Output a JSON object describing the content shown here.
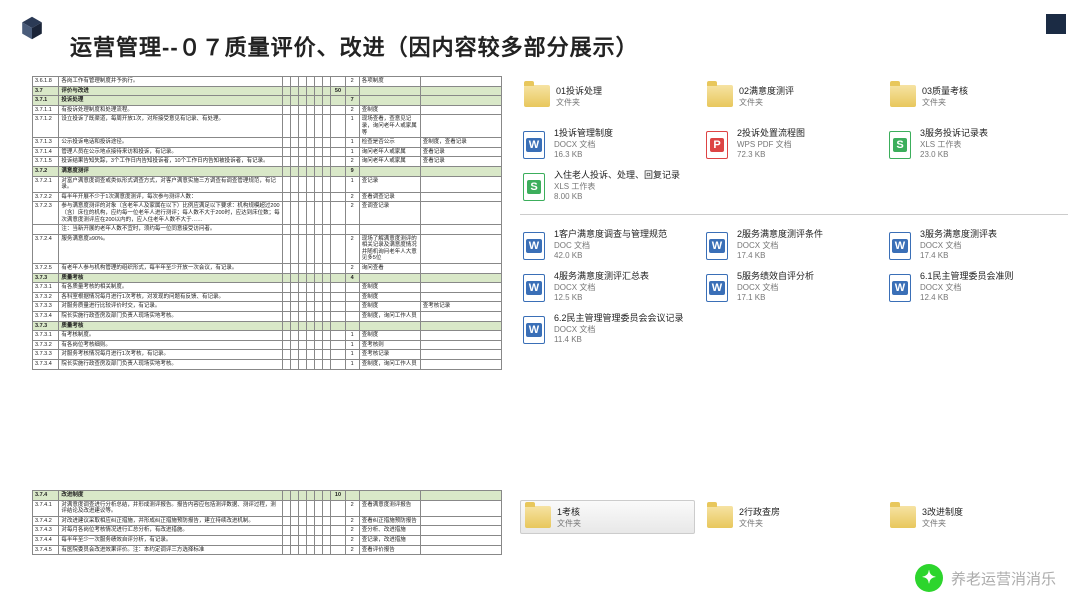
{
  "title": "运营管理--０７质量评价、改进（因内容较多部分展示）",
  "watermark": "养老运营消消乐",
  "table1": [
    {
      "id": "3.6.1.8",
      "desc": "各岗工作有管理制度并予执行。",
      "n1": "",
      "n2": "2",
      "r1": "各项制度",
      "r2": ""
    },
    {
      "id": "3.7",
      "desc": "评价与改进",
      "n1": "50",
      "n2": "",
      "r1": "",
      "r2": "",
      "cls": "sec"
    },
    {
      "id": "3.7.1",
      "desc": "投诉处理",
      "n1": "",
      "n2": "7",
      "r1": "",
      "r2": "",
      "cls": "sec"
    },
    {
      "id": "3.7.1.1",
      "desc": "有投诉处理制度和处理流程。",
      "n1": "",
      "n2": "2",
      "r1": "查制度",
      "r2": ""
    },
    {
      "id": "3.7.1.2",
      "desc": "设立投诉了既渠道，每周开放1次，对所接受意见有记录、有处理。",
      "n1": "",
      "n2": "1",
      "r1": "现场查看，查意见记录，询问老年人或家属等",
      "r2": ""
    },
    {
      "id": "3.7.1.3",
      "desc": "公示投诉电话和投诉途径。",
      "n1": "",
      "n2": "1",
      "r1": "检查是否公示",
      "r2": "查制度，查看记录"
    },
    {
      "id": "3.7.1.4",
      "desc": "管理人员在公示地点接待来访和投诉，有记录。",
      "n1": "",
      "n2": "1",
      "r1": "询问老年人或家属",
      "r2": "查看记录"
    },
    {
      "id": "3.7.1.5",
      "desc": "投诉结果告知失踪，3个工作日内告知投诉者，10个工作日内告知被投诉者，有记录。",
      "n1": "",
      "n2": "2",
      "r1": "询问老年人或家属",
      "r2": "查看记录"
    },
    {
      "id": "3.7.2",
      "desc": "满意度测评",
      "n1": "",
      "n2": "9",
      "r1": "",
      "r2": "",
      "cls": "sec"
    },
    {
      "id": "3.7.2.1",
      "desc": "对富户满意度调查或类似形式调查方式，对客户满意实施三方调查有调查管理规范，有记录。",
      "n1": "",
      "n2": "1",
      "r1": "查记录",
      "r2": ""
    },
    {
      "id": "3.7.2.2",
      "desc": "每半年开展不少于1次满意度测评，每次参与测评人数：",
      "n1": "",
      "n2": "2",
      "r1": "查看调查记录",
      "r2": ""
    },
    {
      "id": "3.7.2.3",
      "desc": "参与满意度测评的对象（含老年人及家属在以下）比例应满足以下要求：机构规模超过200（含）床位的机构，应约每一位老年人进行测评；每人数不大于200时，应达到床位数；每次满意度测评应在200以内的，应入住老年人数不大于……",
      "n1": "",
      "n2": "2",
      "r1": "查调查记录",
      "r2": ""
    },
    {
      "id": "",
      "desc": "注：当新开展的老年人数不宜时，须约每一位同意接受访问者。",
      "n1": "",
      "n2": "",
      "r1": "",
      "r2": ""
    },
    {
      "id": "3.7.2.4",
      "desc": "服务满意度≥90%。",
      "n1": "",
      "n2": "2",
      "r1": "现场了解满意度测评的相关记录及满意度情况并随机询问老年人大意见多5位",
      "r2": ""
    },
    {
      "id": "3.7.2.5",
      "desc": "有老年人参与机构管理的组织形式，每半年至少开放一次会议，有记录。",
      "n1": "",
      "n2": "2",
      "r1": "询问查看",
      "r2": ""
    },
    {
      "id": "3.7.3",
      "desc": "质量考核",
      "n1": "",
      "n2": "4",
      "r1": "",
      "r2": "",
      "cls": "sec"
    },
    {
      "id": "3.7.3.1",
      "desc": "有各质量考核的相关制度。",
      "n1": "",
      "n2": "",
      "r1": "查制度",
      "r2": ""
    },
    {
      "id": "3.7.3.2",
      "desc": "各科室根据情况每月进行1次考核，对发现的问题有反馈、有记录。",
      "n1": "",
      "n2": "",
      "r1": "查制度",
      "r2": ""
    },
    {
      "id": "3.7.3.3",
      "desc": "对服务质量进行比较评价时交，有记录。",
      "n1": "",
      "n2": "",
      "r1": "查制度",
      "r2": "查考核记录"
    },
    {
      "id": "3.7.3.4",
      "desc": "院长实施行政查房及部门负责人现场实地考核。",
      "n1": "",
      "n2": "",
      "r1": "查制度，询问工作人员",
      "r2": ""
    },
    {
      "id": "3.7.3",
      "desc": "质量考核",
      "n1": "",
      "n2": "",
      "r1": "",
      "r2": "",
      "cls": "sec"
    },
    {
      "id": "3.7.3.1",
      "desc": "有考核制度。",
      "n1": "",
      "n2": "1",
      "r1": "查制度",
      "r2": ""
    },
    {
      "id": "3.7.3.2",
      "desc": "有各岗位考核细则。",
      "n1": "",
      "n2": "1",
      "r1": "查考核则",
      "r2": ""
    },
    {
      "id": "3.7.3.3",
      "desc": "对服务考核情况每月进行1次考核，有记录。",
      "n1": "",
      "n2": "1",
      "r1": "查考核记录",
      "r2": ""
    },
    {
      "id": "3.7.3.4",
      "desc": "院长实施行政查房及部门负责人现场实地考核。",
      "n1": "",
      "n2": "1",
      "r1": "查制度，询问工作人员",
      "r2": ""
    }
  ],
  "table2": [
    {
      "id": "3.7.4",
      "desc": "改进制度",
      "n1": "10",
      "n2": "",
      "r1": "",
      "r2": "",
      "cls": "sec"
    },
    {
      "id": "3.7.4.1",
      "desc": "对满意度调查进行分析总结，并形成测评报告。报告内容应包括测评数据、测评过程，测评结论及改进建议等。",
      "n1": "",
      "n2": "2",
      "r1": "查看满意度测评报告",
      "r2": ""
    },
    {
      "id": "3.7.4.2",
      "desc": "对改进建议采取相应纠正措施，并形成纠正措施预防报告，建立持续改进机制。",
      "n1": "",
      "n2": "2",
      "r1": "查看纠正措施预防报告",
      "r2": ""
    },
    {
      "id": "3.7.4.3",
      "desc": "对每月各岗位考核情况进行汇总分析，有改进措施。",
      "n1": "",
      "n2": "2",
      "r1": "查分析、改进措施",
      "r2": ""
    },
    {
      "id": "3.7.4.4",
      "desc": "每半年至少一次服务绩效自评分析，有记录。",
      "n1": "",
      "n2": "2",
      "r1": "查记录，改进措施",
      "r2": ""
    },
    {
      "id": "3.7.4.5",
      "desc": "有医院委员会改进效果评价。注：本约定调评三方选择标准",
      "n1": "",
      "n2": "2",
      "r1": "查看评价报告",
      "r2": ""
    }
  ],
  "folders1": [
    {
      "name": "01投诉处理",
      "type": "文件夹"
    },
    {
      "name": "02满意度测评",
      "type": "文件夹"
    },
    {
      "name": "03质量考核",
      "type": "文件夹"
    }
  ],
  "files_g1": [
    {
      "name": "1投诉管理制度",
      "type": "DOCX 文档",
      "size": "16.3 KB",
      "ico": "w"
    },
    {
      "name": "2投诉处置流程图",
      "type": "WPS PDF 文档",
      "size": "72.3 KB",
      "ico": "p"
    },
    {
      "name": "3服务投诉记录表",
      "type": "XLS 工作表",
      "size": "23.0 KB",
      "ico": "s"
    },
    {
      "name": "入住老人投诉、处理、回复记录",
      "type": "XLS 工作表",
      "size": "8.00 KB",
      "ico": "s"
    }
  ],
  "files_g2": [
    {
      "name": "1客户满意度调查与管理规范",
      "type": "DOC 文档",
      "size": "42.0 KB",
      "ico": "w"
    },
    {
      "name": "2服务满意度测评条件",
      "type": "DOCX 文档",
      "size": "17.4 KB",
      "ico": "w"
    },
    {
      "name": "3服务满意度测评表",
      "type": "DOCX 文档",
      "size": "17.4 KB",
      "ico": "w"
    },
    {
      "name": "4服务满意度测评汇总表",
      "type": "DOCX 文档",
      "size": "12.5 KB",
      "ico": "w"
    },
    {
      "name": "5服务绩效自评分析",
      "type": "DOCX 文档",
      "size": "17.1 KB",
      "ico": "w"
    },
    {
      "name": "6.1民主管理委员会准则",
      "type": "DOCX 文档",
      "size": "12.4 KB",
      "ico": "w"
    },
    {
      "name": "6.2民主管理管理委员会会议记录",
      "type": "DOCX 文档",
      "size": "11.4 KB",
      "ico": "w"
    }
  ],
  "folders2": [
    {
      "name": "1考核",
      "type": "文件夹",
      "sel": true
    },
    {
      "name": "2行政查房",
      "type": "文件夹"
    },
    {
      "name": "3改进制度",
      "type": "文件夹"
    }
  ]
}
